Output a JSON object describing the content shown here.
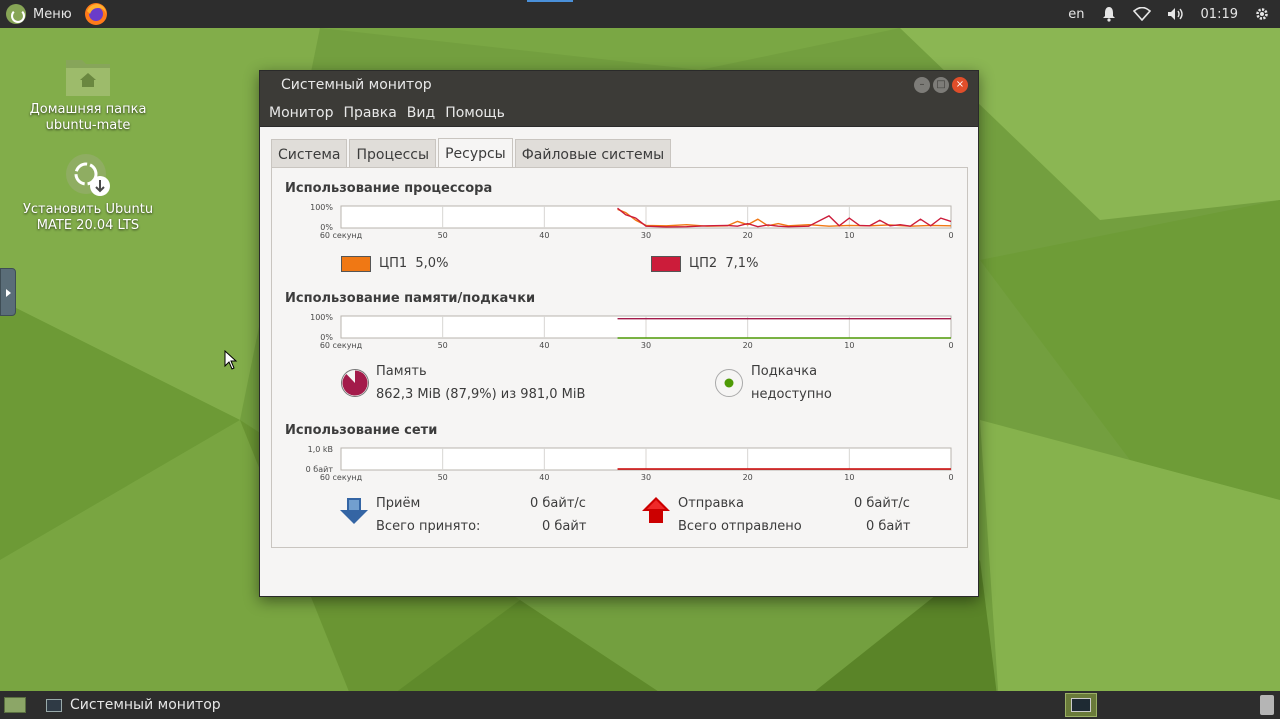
{
  "top_panel": {
    "menu_label": "Меню",
    "keyboard_layout": "en",
    "clock": "01:19"
  },
  "desktop": {
    "icons": [
      {
        "label_line1": "Домашняя папка",
        "label_line2": "ubuntu-mate"
      },
      {
        "label_line1": "Установить Ubuntu",
        "label_line2": "MATE 20.04 LTS"
      }
    ]
  },
  "window": {
    "title": "Системный монитор",
    "menu": [
      "Монитор",
      "Правка",
      "Вид",
      "Помощь"
    ],
    "tabs": [
      {
        "label": "Система",
        "active": false
      },
      {
        "label": "Процессы",
        "active": false
      },
      {
        "label": "Ресурсы",
        "active": true
      },
      {
        "label": "Файловые системы",
        "active": false
      }
    ],
    "x_ticks": [
      "60 секунд",
      "50",
      "40",
      "30",
      "20",
      "10",
      "0"
    ],
    "cpu": {
      "title": "Использование процессора",
      "y_top": "100%",
      "y_bottom": "0%",
      "series": [
        {
          "name": "ЦП1",
          "value": "5,0%",
          "color": "#f07814"
        },
        {
          "name": "ЦП2",
          "value": "7,1%",
          "color": "#cc1c3a"
        }
      ]
    },
    "memory": {
      "title": "Использование памяти/подкачки",
      "y_top": "100%",
      "y_bottom": "0%",
      "mem_label": "Память",
      "mem_value": "862,3 MiB (87,9%) из 981,0 MiB",
      "mem_fraction": 0.879,
      "mem_color": "#a31a4a",
      "swap_label": "Подкачка",
      "swap_value": "недоступно",
      "swap_color": "#4e9a06"
    },
    "network": {
      "title": "Использование сети",
      "y_top": "1,0 kB",
      "y_bottom": "0 байт",
      "recv_label": "Приём",
      "recv_rate": "0 байт/с",
      "recv_total_label": "Всего принято:",
      "recv_total": "0 байт",
      "recv_color": "#3465a4",
      "send_label": "Отправка",
      "send_rate": "0 байт/с",
      "send_total_label": "Всего отправлено",
      "send_total": "0 байт",
      "send_color": "#cc0000"
    }
  },
  "bottom_panel": {
    "taskbar_item": "Системный монитор"
  }
}
